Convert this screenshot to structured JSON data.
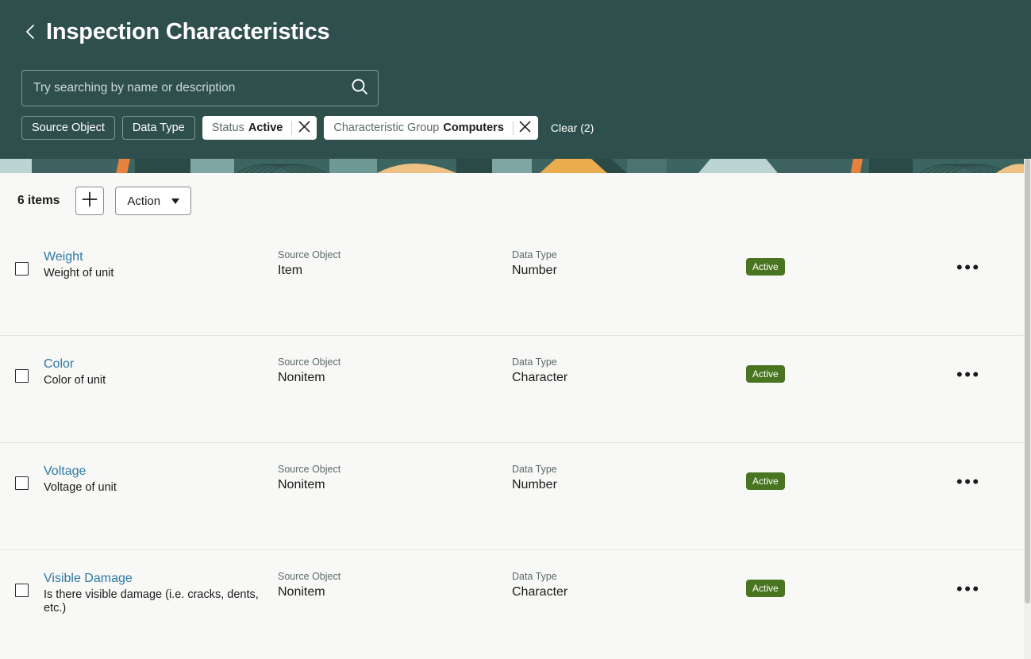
{
  "header": {
    "back_icon": "chevron-left-icon",
    "title": "Inspection Characteristics",
    "background_color": "#2f4f4c",
    "search": {
      "placeholder": "Try searching by name or description",
      "value": "",
      "icon": "search-icon"
    },
    "filters": {
      "chips": [
        {
          "kind": "plain",
          "label": "Source Object"
        },
        {
          "kind": "plain",
          "label": "Data Type"
        },
        {
          "kind": "active",
          "label": "Status",
          "value": "Active",
          "remove_icon": "close-icon"
        },
        {
          "kind": "active",
          "label": "Characteristic Group",
          "value": "Computers",
          "remove_icon": "close-icon"
        }
      ],
      "clear_label": "Clear (2)"
    }
  },
  "toolbar": {
    "item_count": "6 items",
    "add_icon": "plus-icon",
    "action_label": "Action",
    "action_caret_icon": "chevron-down-icon"
  },
  "columns": {
    "source_object": "Source Object",
    "data_type": "Data Type"
  },
  "rows": [
    {
      "name": "Weight",
      "description": "Weight of unit",
      "source_object": "Item",
      "data_type": "Number",
      "status": "Active",
      "status_color": "#497521",
      "menu_icon": "more-options-icon"
    },
    {
      "name": "Color",
      "description": "Color of unit",
      "source_object": "Nonitem",
      "data_type": "Character",
      "status": "Active",
      "status_color": "#497521",
      "menu_icon": "more-options-icon"
    },
    {
      "name": "Voltage",
      "description": "Voltage of unit",
      "source_object": "Nonitem",
      "data_type": "Number",
      "status": "Active",
      "status_color": "#497521",
      "menu_icon": "more-options-icon"
    },
    {
      "name": "Visible Damage",
      "description": "Is there visible damage (i.e. cracks, dents, etc.)",
      "source_object": "Nonitem",
      "data_type": "Character",
      "status": "Active",
      "status_color": "#497521",
      "menu_icon": "more-options-icon"
    }
  ]
}
